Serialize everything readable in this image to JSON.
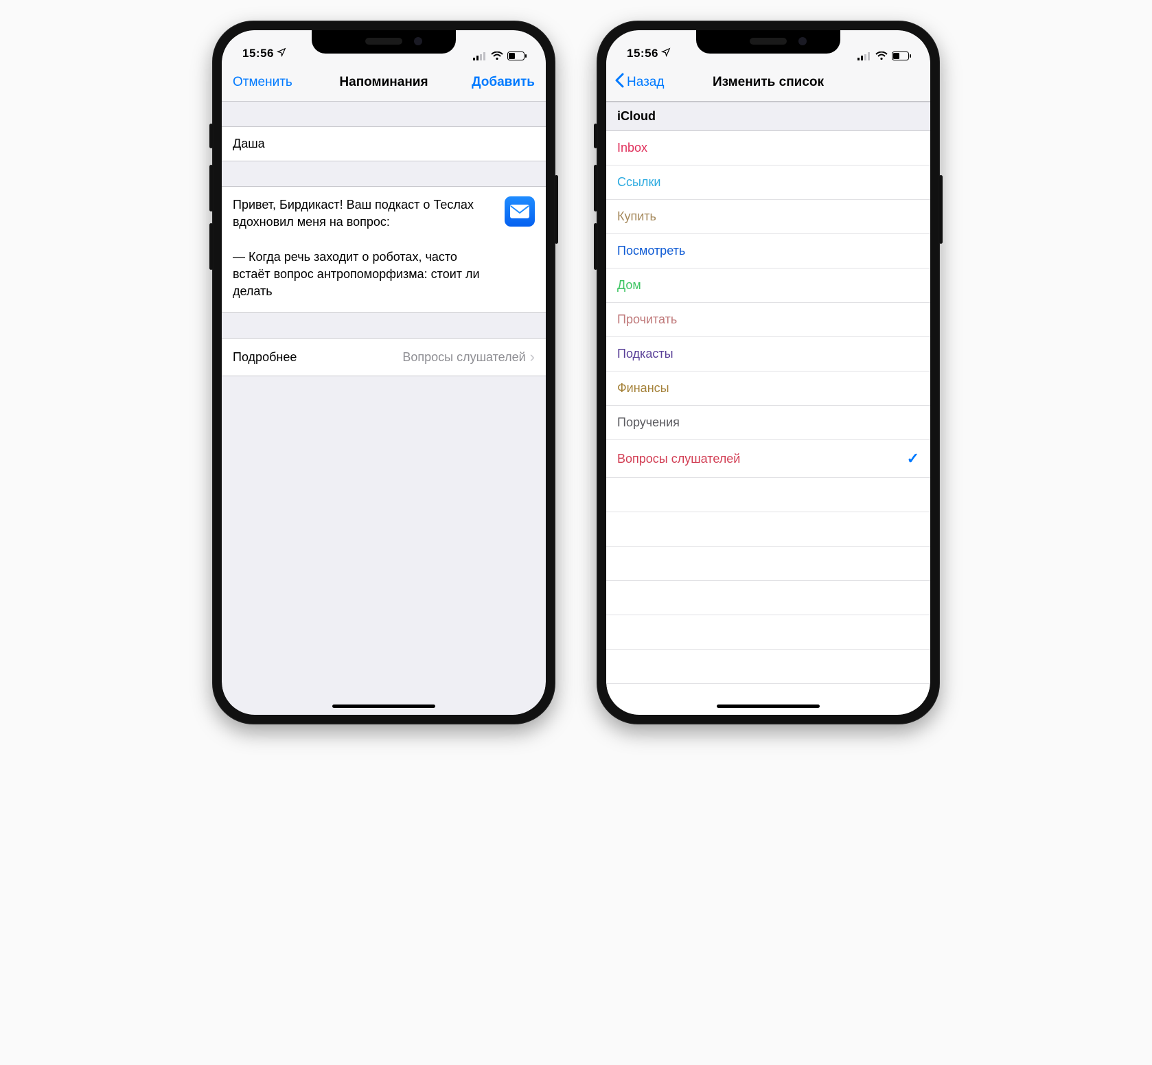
{
  "status": {
    "time": "15:56",
    "location_icon": "location-arrow-icon",
    "signal_bars": 2,
    "wifi_bars": 3
  },
  "left_phone": {
    "nav": {
      "cancel": "Отменить",
      "title": "Напоминания",
      "add": "Добавить"
    },
    "title_field": "Даша",
    "note_text": "Привет, Бирдикаст! Ваш подкаст о Теслах вдохновил меня на вопрос:\n\n— Когда речь заходит о роботах, часто встаёт вопрос антропоморфизма: стоит ли делать",
    "attachment_icon": "mail-app-icon",
    "details_row": {
      "label": "Подробнее",
      "value": "Вопросы слушателей"
    }
  },
  "right_phone": {
    "nav": {
      "back": "Назад",
      "title": "Изменить список"
    },
    "section_header": "iCloud",
    "lists": [
      {
        "name": "Inbox",
        "color": "#e0315c",
        "selected": false
      },
      {
        "name": "Ссылки",
        "color": "#2eabe0",
        "selected": false
      },
      {
        "name": "Купить",
        "color": "#a68a5d",
        "selected": false
      },
      {
        "name": "Посмотреть",
        "color": "#0f5bd4",
        "selected": false
      },
      {
        "name": "Дом",
        "color": "#3fc564",
        "selected": false
      },
      {
        "name": "Прочитать",
        "color": "#c07a7b",
        "selected": false
      },
      {
        "name": "Подкасты",
        "color": "#5a4098",
        "selected": false
      },
      {
        "name": "Финансы",
        "color": "#a5823a",
        "selected": false
      },
      {
        "name": "Поручения",
        "color": "#5b5b60",
        "selected": false
      },
      {
        "name": "Вопросы слушателей",
        "color": "#d23e54",
        "selected": true
      }
    ]
  }
}
